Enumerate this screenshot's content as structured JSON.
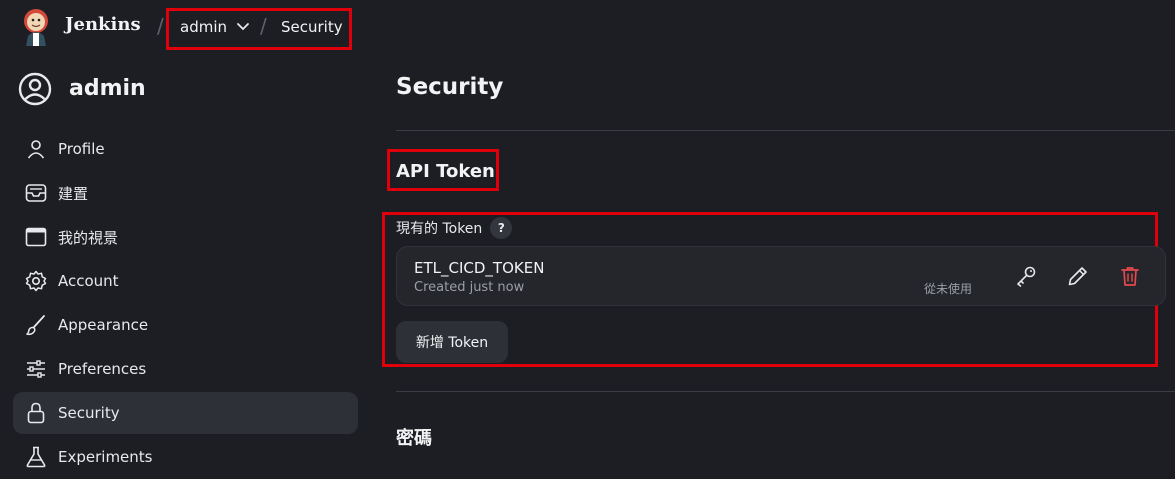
{
  "header": {
    "brand": "Jenkins",
    "breadcrumbs": [
      {
        "label": "admin",
        "has_dropdown": true
      },
      {
        "label": "Security"
      }
    ],
    "separator": "/"
  },
  "sidebar": {
    "user_name": "admin",
    "items": [
      {
        "label": "Profile",
        "icon": "person-icon"
      },
      {
        "label": "建置",
        "icon": "inbox-icon"
      },
      {
        "label": "我的視景",
        "icon": "window-icon"
      },
      {
        "label": "Account",
        "icon": "gear-icon"
      },
      {
        "label": "Appearance",
        "icon": "brush-icon"
      },
      {
        "label": "Preferences",
        "icon": "sliders-icon"
      },
      {
        "label": "Security",
        "icon": "lock-icon",
        "active": true
      },
      {
        "label": "Experiments",
        "icon": "flask-icon"
      }
    ]
  },
  "main": {
    "title": "Security",
    "api_section_title": "API Token",
    "existing_tokens_label": "現有的 Token",
    "help_label": "?",
    "tokens": [
      {
        "name": "ETL_CICD_TOKEN",
        "created": "Created just now",
        "usage": "從未使用"
      }
    ],
    "add_token_label": "新增 Token",
    "password_section_title": "密碼"
  },
  "colors": {
    "background": "#1c1e23",
    "highlight_box": "#e0000b",
    "delete_icon": "#e5484d",
    "active_nav": "#2d3037"
  }
}
